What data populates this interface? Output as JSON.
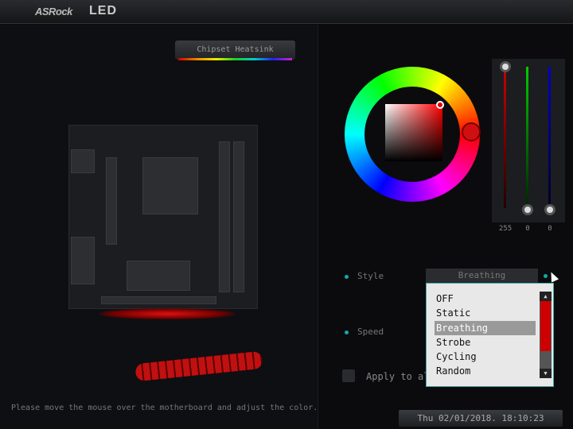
{
  "header": {
    "brand": "ASRock",
    "title": "LED"
  },
  "zone": {
    "label": "Chipset Heatsink"
  },
  "hint": "Please move the mouse over the motherboard and adjust the color.",
  "rgb": {
    "red": 255,
    "green": 0,
    "blue": 0,
    "red_label": "255",
    "green_label": "0",
    "blue_label": "0"
  },
  "style": {
    "label": "Style",
    "value": "Breathing",
    "options": [
      "OFF",
      "Static",
      "Breathing",
      "Strobe",
      "Cycling",
      "Random"
    ]
  },
  "speed": {
    "label": "Speed"
  },
  "apply": {
    "label": "Apply to all"
  },
  "clock": "Thu 02/01/2018. 18:10:23",
  "colors": {
    "accent": "#11aaaa",
    "selected": "#ff0000"
  }
}
